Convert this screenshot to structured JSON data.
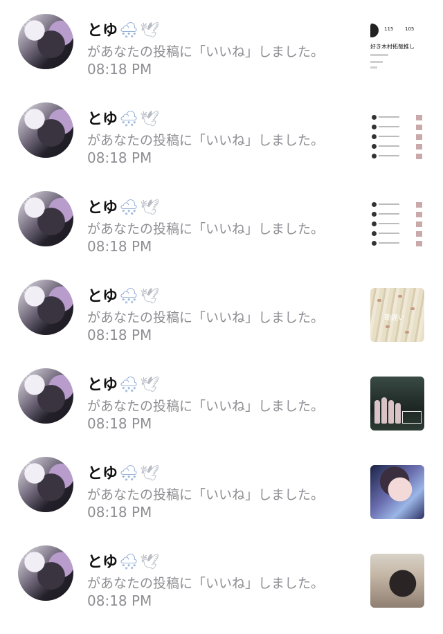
{
  "notifications": [
    {
      "user": "とゆ",
      "emoji": "🌨",
      "emoji2": "🕊",
      "message": "があなたの投稿に「いいね」しました。",
      "time": "08:18 PM",
      "thumb": "profile-screenshot",
      "profile_nums": [
        "115",
        "105"
      ],
      "profile_bio": "好き木村拓哉推し"
    },
    {
      "user": "とゆ",
      "emoji": "🌨",
      "emoji2": "🕊",
      "message": "があなたの投稿に「いいね」しました。",
      "time": "08:18 PM",
      "thumb": "list-screenshot"
    },
    {
      "user": "とゆ",
      "emoji": "🌨",
      "emoji2": "🕊",
      "message": "があなたの投稿に「いいね」しました。",
      "time": "08:18 PM",
      "thumb": "list-screenshot"
    },
    {
      "user": "とゆ",
      "emoji": "🌨",
      "emoji2": "🕊",
      "message": "があなたの投稿に「いいね」しました。",
      "time": "08:18 PM",
      "thumb": "fabric-photo",
      "thumb_text": "勘違い"
    },
    {
      "user": "とゆ",
      "emoji": "🌨",
      "emoji2": "🕊",
      "message": "があなたの投稿に「いいね」しました。",
      "time": "08:18 PM",
      "thumb": "group-photo"
    },
    {
      "user": "とゆ",
      "emoji": "🌨",
      "emoji2": "🕊",
      "message": "があなたの投稿に「いいね」しました。",
      "time": "08:18 PM",
      "thumb": "portrait-photo"
    },
    {
      "user": "とゆ",
      "emoji": "🌨",
      "emoji2": "🕊",
      "message": "があなたの投稿に「いいね」しました。",
      "time": "08:18 PM",
      "thumb": "photo"
    }
  ]
}
